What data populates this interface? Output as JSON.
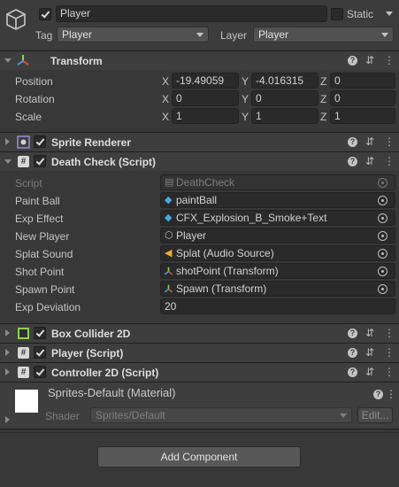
{
  "object": {
    "name": "Player",
    "active": true,
    "static_label": "Static",
    "tag_label": "Tag",
    "tag_value": "Player",
    "layer_label": "Layer",
    "layer_value": "Player"
  },
  "transform": {
    "title": "Transform",
    "rows": [
      {
        "label": "Position",
        "x": "-19.49059",
        "y": "-4.016315",
        "z": "0"
      },
      {
        "label": "Rotation",
        "x": "0",
        "y": "0",
        "z": "0"
      },
      {
        "label": "Scale",
        "x": "1",
        "y": "1",
        "z": "1"
      }
    ],
    "axis": {
      "x": "X",
      "y": "Y",
      "z": "Z"
    }
  },
  "sprite_renderer": {
    "title": "Sprite Renderer"
  },
  "death_check": {
    "title": "Death Check (Script)",
    "script_label": "Script",
    "script_value": "DeathCheck",
    "fields": [
      {
        "label": "Paint Ball",
        "value": "paintBall",
        "icon": "prefab-icon"
      },
      {
        "label": "Exp Effect",
        "value": "CFX_Explosion_B_Smoke+Text",
        "icon": "prefab-icon"
      },
      {
        "label": "New Player",
        "value": "Player",
        "icon": "gameobject-icon"
      },
      {
        "label": "Splat Sound",
        "value": "Splat (Audio Source)",
        "icon": "audio-source-icon"
      },
      {
        "label": "Shot Point",
        "value": "shotPoint (Transform)",
        "icon": "transform-icon"
      },
      {
        "label": "Spawn Point",
        "value": "Spawn (Transform)",
        "icon": "transform-icon"
      }
    ],
    "exp_deviation_label": "Exp Deviation",
    "exp_deviation_value": "20"
  },
  "box_collider": {
    "title": "Box Collider 2D"
  },
  "player_script": {
    "title": "Player (Script)"
  },
  "controller_script": {
    "title": "Controller 2D (Script)"
  },
  "material": {
    "title": "Sprites-Default (Material)",
    "shader_label": "Shader",
    "shader_value": "Sprites/Default",
    "edit_label": "Edit..."
  },
  "add_component_label": "Add Component"
}
